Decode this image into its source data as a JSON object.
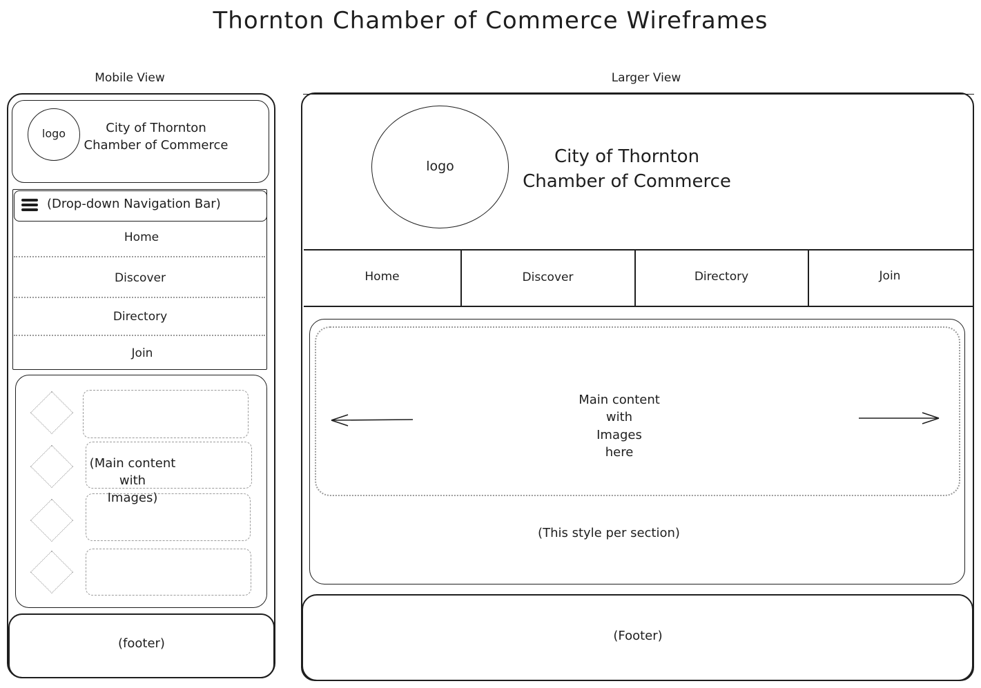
{
  "title": "Thornton Chamber of Commerce Wireframes",
  "mobile": {
    "label": "Mobile View",
    "logo": "logo",
    "org_line1": "City of Thornton",
    "org_line2": "Chamber of Commerce",
    "nav_toggle": "(Drop-down Navigation Bar)",
    "nav_items": [
      "Home",
      "Discover",
      "Directory",
      "Join"
    ],
    "content_line1": "(Main content",
    "content_line2": "with",
    "content_line3": "Images)",
    "footer": "(footer)"
  },
  "larger": {
    "label": "Larger View",
    "logo": "logo",
    "org_line1": "City of Thornton",
    "org_line2": "Chamber of Commerce",
    "nav_items": [
      "Home",
      "Discover",
      "Directory",
      "Join"
    ],
    "content_line1": "Main content",
    "content_line2": "with",
    "content_line3": "Images",
    "content_line4": "here",
    "section_note": "(This style per section)",
    "footer": "(Footer)"
  }
}
